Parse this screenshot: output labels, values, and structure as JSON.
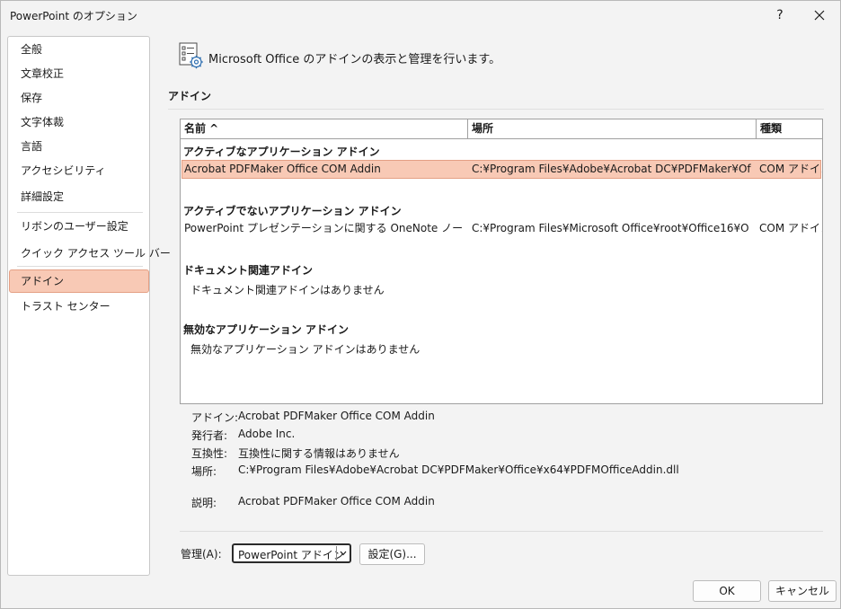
{
  "window": {
    "title": "PowerPoint のオプション",
    "help_glyph": "?",
    "close_icon": "close-icon"
  },
  "sidebar": {
    "items": [
      {
        "label": "全般"
      },
      {
        "label": "文章校正"
      },
      {
        "label": "保存"
      },
      {
        "label": "文字体裁"
      },
      {
        "label": "言語"
      },
      {
        "label": "アクセシビリティ"
      },
      {
        "label": "詳細設定"
      },
      {
        "label": "リボンのユーザー設定"
      },
      {
        "label": "クイック アクセス ツール バー"
      },
      {
        "label": "アドイン",
        "selected": true
      },
      {
        "label": "トラスト センター"
      }
    ]
  },
  "main": {
    "header_icon": "addins-gear-icon",
    "header_text": "Microsoft Office のアドインの表示と管理を行います。",
    "section_title": "アドイン",
    "columns": {
      "name": "名前 ^",
      "location": "場所",
      "type": "種類"
    },
    "groups": {
      "active": {
        "label": "アクティブなアプリケーション アドイン",
        "rows": [
          {
            "name": "Acrobat PDFMaker Office COM Addin",
            "location": "C:¥Program Files¥Adobe¥Acrobat DC¥PDFMaker¥Of",
            "type": "COM アドイン",
            "selected": true
          }
        ]
      },
      "inactive": {
        "label": "アクティブでないアプリケーション アドイン",
        "rows": [
          {
            "name": "PowerPoint プレゼンテーションに関する OneNote ノート",
            "location": "C:¥Program Files¥Microsoft Office¥root¥Office16¥O",
            "type": "COM アドイン"
          }
        ]
      },
      "document": {
        "label": "ドキュメント関連アドイン",
        "empty_text": "ドキュメント関連アドインはありません"
      },
      "disabled": {
        "label": "無効なアプリケーション アドイン",
        "empty_text": "無効なアプリケーション アドインはありません"
      }
    },
    "details": {
      "addin": {
        "label": "アドイン:",
        "value": "Acrobat PDFMaker Office COM Addin"
      },
      "publisher": {
        "label": "発行者:",
        "value": "Adobe Inc."
      },
      "compatibility": {
        "label": "互換性:",
        "value": "互換性に関する情報はありません"
      },
      "location": {
        "label": "場所:",
        "value": "C:¥Program Files¥Adobe¥Acrobat DC¥PDFMaker¥Office¥x64¥PDFMOfficeAddin.dll"
      },
      "description": {
        "label": "説明:",
        "value": "Acrobat PDFMaker Office COM Addin"
      }
    },
    "manage": {
      "label": "管理(A):",
      "selected": "PowerPoint アドイン",
      "go_button": "設定(G)..."
    }
  },
  "footer": {
    "ok": "OK",
    "cancel": "キャンセル"
  },
  "colors": {
    "selection_fill": "#f8c9b5",
    "selection_border": "#e49f84",
    "window_bg": "#f3f3f3"
  }
}
